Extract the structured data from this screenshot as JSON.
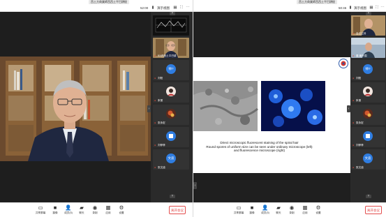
{
  "left_window": {
    "title": "西土方商業師西西土平巴耕極",
    "toolbar": {
      "timer": "52:00",
      "view_label": "演示视图",
      "window_controls": [
        "grid-icon",
        "fullscreen-icon",
        "more-icon"
      ]
    },
    "main_video": {
      "description_icon": "presenter-video"
    },
    "sidebar": {
      "tiles": [
        {
          "kind": "chart",
          "name": ""
        },
        {
          "kind": "video",
          "name": "51/西西土平巴耕"
        },
        {
          "kind": "avatar",
          "initial": "帅?",
          "color": "#2f7de1",
          "name": "刘阳"
        },
        {
          "kind": "photo",
          "name": "朱丽"
        },
        {
          "kind": "photo",
          "name": "张永宏"
        },
        {
          "kind": "photo",
          "name": "刘菲菲"
        },
        {
          "kind": "avatar",
          "initial": "文迪",
          "color": "#2f7de1",
          "name": "张文迪"
        }
      ]
    },
    "bottom_bar": {
      "controls": [
        {
          "icon": "screen-share-icon",
          "label": "共享屏幕"
        },
        {
          "icon": "camera-icon",
          "label": "摄像"
        },
        {
          "icon": "participants-icon",
          "label": "成员(5)"
        },
        {
          "icon": "chat-icon",
          "label": "聊天"
        },
        {
          "icon": "record-icon",
          "label": "录制"
        },
        {
          "icon": "apps-icon",
          "label": "应用"
        },
        {
          "icon": "settings-icon",
          "label": "设置"
        }
      ],
      "leave_label": "离开会议"
    }
  },
  "right_window": {
    "title": "西土方商業師西西土平巴耕極",
    "toolbar": {
      "timer": "50:46",
      "view_label": "演示视图",
      "window_controls": [
        "grid-icon",
        "fullscreen-icon",
        "more-icon"
      ]
    },
    "slide": {
      "caption_line1": "Direct microscopic fluorescent staining of the spiral hair",
      "caption_line2": "Round spores of uniform size can be seen under ordinary microscope (left)",
      "caption_line3": "and fluorescence microscope (right)"
    },
    "sidebar": {
      "tiles": [
        {
          "kind": "video",
          "name": "会议主持"
        },
        {
          "kind": "video",
          "name": "董-最外围"
        },
        {
          "kind": "avatar",
          "initial": "帅?",
          "color": "#2f7de1",
          "name": "刘阳"
        },
        {
          "kind": "photo",
          "name": "朱丽"
        },
        {
          "kind": "photo",
          "name": "张永宏"
        },
        {
          "kind": "photo",
          "name": "刘菲菲"
        },
        {
          "kind": "avatar",
          "initial": "文迪",
          "color": "#2f7de1",
          "name": "张文迪"
        }
      ]
    },
    "bottom_bar": {
      "controls": [
        {
          "icon": "screen-share-icon",
          "label": "共享屏幕"
        },
        {
          "icon": "camera-icon",
          "label": "摄像"
        },
        {
          "icon": "participants-icon",
          "label": "成员(5)"
        },
        {
          "icon": "chat-icon",
          "label": "聊天"
        },
        {
          "icon": "record-icon",
          "label": "录制"
        },
        {
          "icon": "apps-icon",
          "label": "应用"
        },
        {
          "icon": "settings-icon",
          "label": "设置"
        }
      ],
      "leave_label": "离开会议"
    }
  },
  "colors": {
    "accent_blue": "#2f7de1",
    "leave_red": "#e34d4d",
    "meeting_bg": "#2b2b2b"
  }
}
